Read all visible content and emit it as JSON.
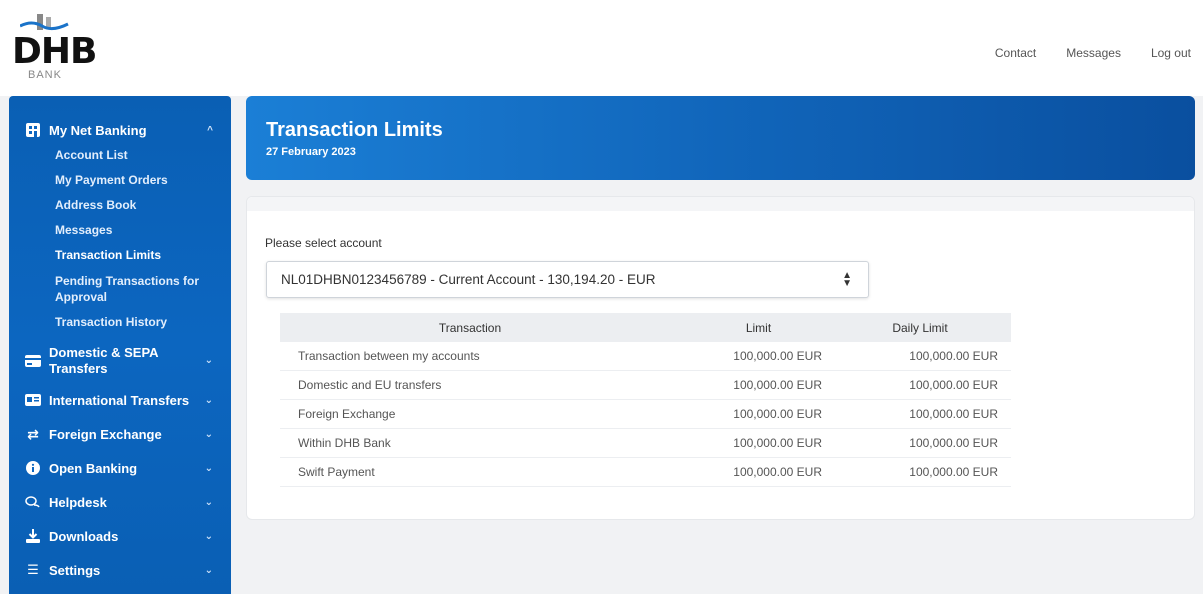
{
  "brand": {
    "name": "DHB",
    "sub": "BANK"
  },
  "top_links": [
    "Contact",
    "Messages",
    "Log out"
  ],
  "sidebar": {
    "my_net_banking": {
      "label": "My Net Banking",
      "items": [
        "Account List",
        "My Payment Orders",
        "Address Book",
        "Messages",
        "Transaction Limits",
        "Pending Transactions for Approval",
        "Transaction History"
      ],
      "active": "Transaction Limits"
    },
    "groups": [
      {
        "label": "Domestic & SEPA Transfers",
        "icon": "card-icon"
      },
      {
        "label": "International Transfers",
        "icon": "id-card-icon"
      },
      {
        "label": "Foreign Exchange",
        "icon": "exchange-icon"
      },
      {
        "label": "Open Banking",
        "icon": "info-icon"
      },
      {
        "label": "Helpdesk",
        "icon": "chat-icon"
      },
      {
        "label": "Downloads",
        "icon": "download-icon"
      },
      {
        "label": "Settings",
        "icon": "list-settings-icon"
      }
    ]
  },
  "page": {
    "title": "Transaction Limits",
    "date": "27 February 2023"
  },
  "form": {
    "label": "Please select account",
    "selected_account": "NL01DHBN0123456789 - Current Account - 130,194.20 - EUR"
  },
  "table": {
    "headers": [
      "Transaction",
      "Limit",
      "Daily Limit"
    ],
    "rows": [
      [
        "Transaction between my accounts",
        "100,000.00 EUR",
        "100,000.00 EUR"
      ],
      [
        "Domestic and EU transfers",
        "100,000.00 EUR",
        "100,000.00 EUR"
      ],
      [
        "Foreign Exchange",
        "100,000.00 EUR",
        "100,000.00 EUR"
      ],
      [
        "Within DHB Bank",
        "100,000.00 EUR",
        "100,000.00 EUR"
      ],
      [
        "Swift Payment",
        "100,000.00 EUR",
        "100,000.00 EUR"
      ]
    ]
  },
  "colors": {
    "primary": "#0c66c0",
    "banner_start": "#1b7fd6",
    "banner_end": "#0a4f9f",
    "background": "#f1f2f4"
  }
}
